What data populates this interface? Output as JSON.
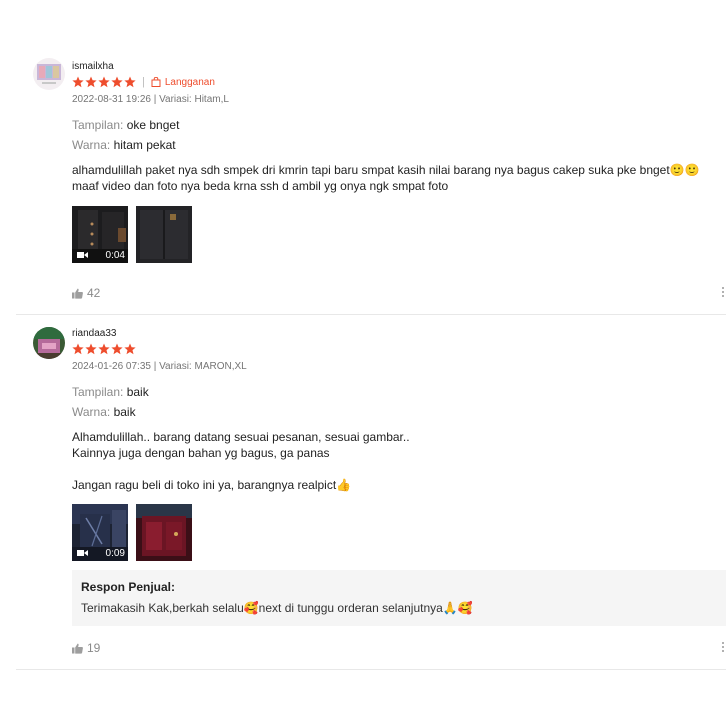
{
  "colors": {
    "accent": "#ee4d2d",
    "muted": "#757575",
    "panel": "#f5f5f5"
  },
  "reviews": [
    {
      "username": "ismailxha",
      "stars": 5,
      "badge_label": "Langganan",
      "meta": "2022-08-31 19:26 | Variasi: Hitam,L",
      "attr1_key": "Tampilan:",
      "attr1_val": "oke bnget",
      "attr2_key": "Warna:",
      "attr2_val": "hitam pekat",
      "text": "alhamdulillah paket nya sdh smpek dri kmrin tapi baru smpat kasih nilai barang nya bagus cakep suka pke bnget🙂🙂maaf video dan foto nya beda krna ssh d ambil yg onya ngk smpat foto",
      "video_duration": "0:04",
      "likes": "42"
    },
    {
      "username": "riandaa33",
      "stars": 5,
      "meta": "2024-01-26 07:35 | Variasi: MARON,XL",
      "attr1_key": "Tampilan:",
      "attr1_val": "baik",
      "attr2_key": "Warna:",
      "attr2_val": "baik",
      "text": "Alhamdulillah.. barang datang sesuai pesanan, sesuai gambar..\nKainnya juga dengan bahan yg bagus, ga panas\n\nJangan ragu beli di toko ini ya, barangnya realpict👍",
      "video_duration": "0:09",
      "seller_title": "Respon Penjual:",
      "seller_text": "Terimakasih Kak,berkah selalu🥰next di tunggu orderan selanjutnya🙏🥰",
      "likes": "19"
    }
  ]
}
